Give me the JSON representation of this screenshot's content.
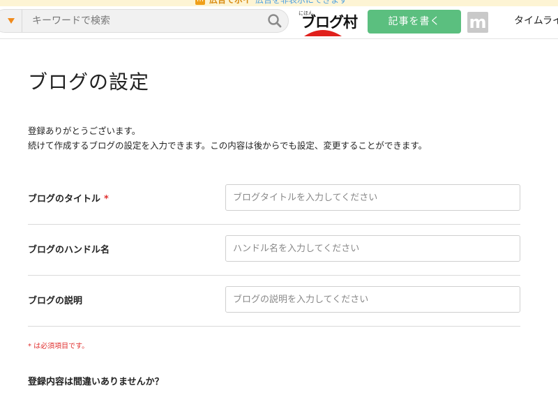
{
  "ad_strip": {
    "badge": "m",
    "bold": "広告でポイ",
    "text": "広告を非表示にできます"
  },
  "header": {
    "search": {
      "placeholder": "キーワードで検索"
    },
    "logo": {
      "small": "にほん",
      "main": "ブログ村"
    },
    "write_button": "記事を書く",
    "m_logo": "m",
    "timeline_link": "タイムライ"
  },
  "page": {
    "title": "ブログの設定",
    "intro_line1": "登録ありがとうございます。",
    "intro_line2": "続けて作成するブログの設定を入力できます。この内容は後からでも設定、変更することができます。"
  },
  "form": {
    "fields": [
      {
        "label": "ブログのタイトル",
        "required_mark": "*",
        "placeholder": "ブログタイトルを入力してください"
      },
      {
        "label": "ブログのハンドル名",
        "placeholder": "ハンドル名を入力してください"
      },
      {
        "label": "ブログの説明",
        "placeholder": "ブログの説明を入力してください"
      }
    ],
    "required_note": "* は必須項目です。",
    "confirm_text": "登録内容は間違いありませんか？"
  },
  "colors": {
    "accent_green": "#5bbf7f",
    "required_red": "#e0302f",
    "caret_orange": "#f08a1c"
  },
  "icons": {
    "search": "search-icon",
    "dropdown": "caret-down-icon"
  }
}
